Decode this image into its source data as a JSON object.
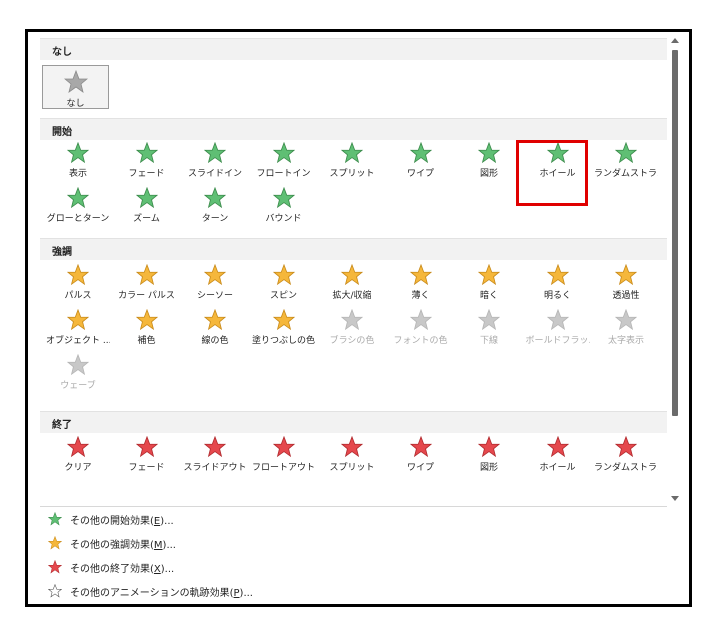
{
  "sections": {
    "none": "なし",
    "entrance": "開始",
    "emphasis": "強調",
    "exit": "終了"
  },
  "none_item": {
    "label": "なし"
  },
  "entrance_items": [
    {
      "label": "表示",
      "icon": "star-appear-icon"
    },
    {
      "label": "フェード",
      "icon": "star-fade-icon"
    },
    {
      "label": "スライドイン",
      "icon": "star-fly-in-icon"
    },
    {
      "label": "フロートイン",
      "icon": "star-float-in-icon"
    },
    {
      "label": "スプリット",
      "icon": "star-split-icon"
    },
    {
      "label": "ワイプ",
      "icon": "star-wipe-icon"
    },
    {
      "label": "図形",
      "icon": "star-shape-icon"
    },
    {
      "label": "ホイール",
      "icon": "star-wheel-icon"
    },
    {
      "label": "ランダムストラ...",
      "icon": "star-random-bars-icon"
    },
    {
      "label": "グローとターン",
      "icon": "star-grow-turn-icon"
    },
    {
      "label": "ズーム",
      "icon": "star-zoom-icon"
    },
    {
      "label": "ターン",
      "icon": "star-swivel-icon"
    },
    {
      "label": "バウンド",
      "icon": "star-bounce-icon"
    }
  ],
  "emphasis_items": [
    {
      "label": "パルス",
      "icon": "star-pulse-icon"
    },
    {
      "label": "カラー パルス",
      "icon": "star-color-pulse-icon"
    },
    {
      "label": "シーソー",
      "icon": "star-teeter-icon"
    },
    {
      "label": "スピン",
      "icon": "star-spin-icon"
    },
    {
      "label": "拡大/収縮",
      "icon": "star-grow-shrink-icon"
    },
    {
      "label": "薄く",
      "icon": "star-desaturate-icon"
    },
    {
      "label": "暗く",
      "icon": "star-darken-icon"
    },
    {
      "label": "明るく",
      "icon": "star-lighten-icon"
    },
    {
      "label": "透過性",
      "icon": "star-transparency-icon"
    },
    {
      "label": "オブジェクト ...",
      "icon": "star-object-color-icon"
    },
    {
      "label": "補色",
      "icon": "star-complementary-icon"
    },
    {
      "label": "線の色",
      "icon": "star-line-color-icon"
    },
    {
      "label": "塗りつぶしの色",
      "icon": "star-fill-color-icon"
    },
    {
      "label": "ブラシの色",
      "icon": "star-brush-color-icon"
    },
    {
      "label": "フォントの色",
      "icon": "star-font-color-icon"
    },
    {
      "label": "下線",
      "icon": "star-underline-icon"
    },
    {
      "label": "ボールドフラッ...",
      "icon": "star-bold-flash-icon"
    },
    {
      "label": "太字表示",
      "icon": "star-bold-reveal-icon"
    },
    {
      "label": "ウェーブ",
      "icon": "star-wave-icon"
    }
  ],
  "exit_items": [
    {
      "label": "クリア",
      "icon": "star-disappear-icon"
    },
    {
      "label": "フェード",
      "icon": "star-fade-out-icon"
    },
    {
      "label": "スライドアウト",
      "icon": "star-fly-out-icon"
    },
    {
      "label": "フロートアウト",
      "icon": "star-float-out-icon"
    },
    {
      "label": "スプリット",
      "icon": "star-split-out-icon"
    },
    {
      "label": "ワイプ",
      "icon": "star-wipe-out-icon"
    },
    {
      "label": "図形",
      "icon": "star-shape-out-icon"
    },
    {
      "label": "ホイール",
      "icon": "star-wheel-out-icon"
    },
    {
      "label": "ランダムストラ...",
      "icon": "star-random-bars-out-icon"
    }
  ],
  "menu": [
    {
      "prefix": "その他の開始効果(",
      "key": "E",
      "suffix": ")...",
      "icon": "green-star-icon"
    },
    {
      "prefix": "その他の強調効果(",
      "key": "M",
      "suffix": ")...",
      "icon": "yellow-star-icon"
    },
    {
      "prefix": "その他の終了効果(",
      "key": "X",
      "suffix": ")...",
      "icon": "red-star-icon"
    },
    {
      "prefix": "その他のアニメーションの軌跡効果(",
      "key": "P",
      "suffix": ")...",
      "icon": "outline-star-icon"
    }
  ],
  "colors": {
    "entrance": "#5fbf74",
    "emphasis": "#f5b73b",
    "exit": "#e5484d",
    "disabled": "#c8c8c8",
    "highlight": "#e00000"
  }
}
